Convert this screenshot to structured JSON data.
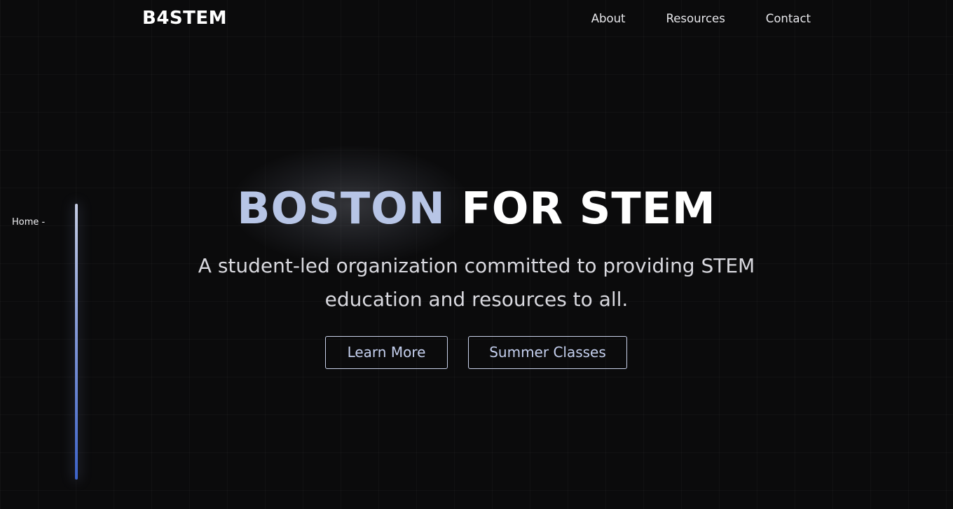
{
  "brand": "B4STEM",
  "nav": {
    "about": "About",
    "resources": "Resources",
    "contact": "Contact"
  },
  "sidebar": {
    "label": "Home -"
  },
  "hero": {
    "title_accent": "BOSTON",
    "title_main": "FOR STEM",
    "subtitle_line1": "A student-led organization committed to providing STEM",
    "subtitle_line2": "education and resources to all."
  },
  "buttons": {
    "learn_more": "Learn More",
    "summer_classes": "Summer Classes"
  },
  "colors": {
    "background": "#0b0b0c",
    "accent": "#b7c5e6",
    "sidebar_gradient_top": "#c6cde4",
    "sidebar_gradient_bottom": "#3d63c9"
  }
}
